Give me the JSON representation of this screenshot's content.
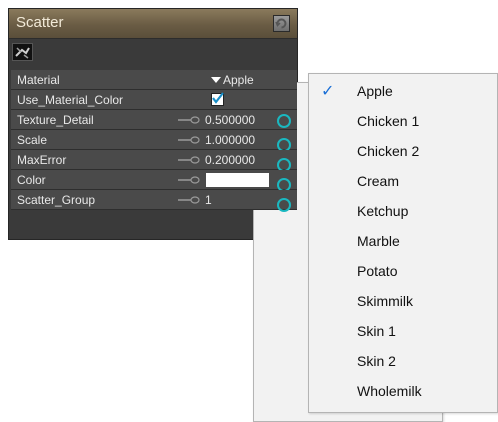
{
  "panel": {
    "title": "Scatter",
    "rows": {
      "material": {
        "label": "Material",
        "value": "Apple"
      },
      "use_material_color": {
        "label": "Use_Material_Color",
        "checked": true
      },
      "texture_detail": {
        "label": "Texture_Detail",
        "value": "0.500000"
      },
      "scale": {
        "label": "Scale",
        "value": "1.000000"
      },
      "max_error": {
        "label": "MaxError",
        "value": "0.200000"
      },
      "color": {
        "label": "Color",
        "value_color": "#ffffff"
      },
      "scatter_group": {
        "label": "Scatter_Group",
        "value": "1"
      }
    }
  },
  "menu": {
    "selected": "Apple",
    "items": [
      "Apple",
      "Chicken 1",
      "Chicken 2",
      "Cream",
      "Ketchup",
      "Marble",
      "Potato",
      "Skimmilk",
      "Skin 1",
      "Skin 2",
      "Wholemilk"
    ]
  },
  "colors": {
    "accent_ring": "#1ab8c0",
    "check": "#1a6fd6",
    "title_bar": "#7a6a50"
  }
}
